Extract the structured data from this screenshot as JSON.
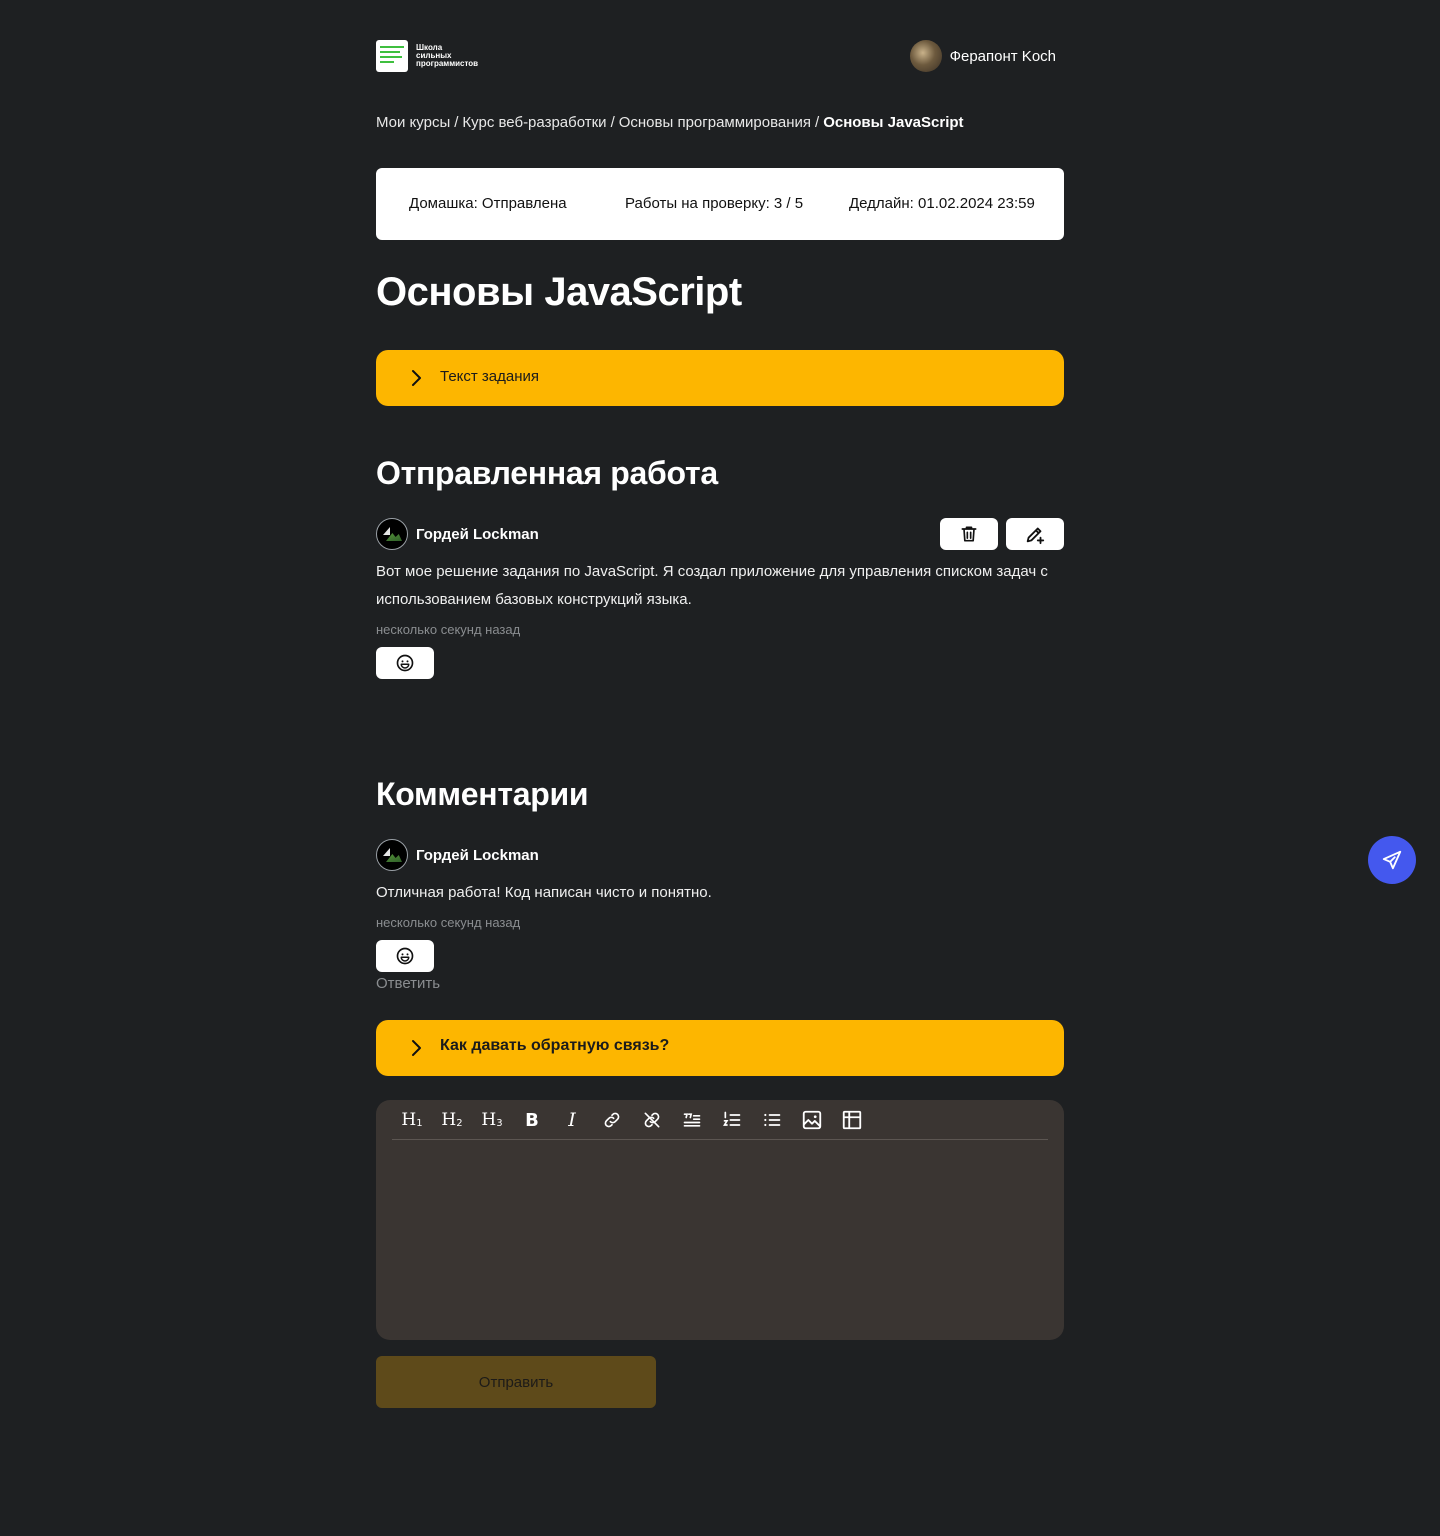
{
  "header": {
    "logo_text": [
      "Школа",
      "сильных",
      "программистов"
    ],
    "user_name": "Ферапонт Koch"
  },
  "breadcrumb": {
    "items": [
      "Мои курсы",
      "Курс веб-разработки",
      "Основы программирования"
    ],
    "current": "Основы JavaScript",
    "separator": "/"
  },
  "status": {
    "homework": "Домашка: Отправлена",
    "review": "Работы на проверку: 3 / 5",
    "deadline": "Дедлайн: 01.02.2024 23:59"
  },
  "page_title": "Основы JavaScript",
  "task_accordion": {
    "label": "Текст задания"
  },
  "submitted": {
    "heading": "Отправленная работа",
    "author": "Гордей Lockman",
    "text": "Вот мое решение задания по JavaScript. Я создал приложение для управления списком задач с использованием базовых конструкций языка.",
    "time": "несколько секунд назад"
  },
  "comments": {
    "heading": "Комментарии",
    "items": [
      {
        "author": "Гордей Lockman",
        "text": "Отличная работа! Код написан чисто и понятно.",
        "time": "несколько секунд назад",
        "reply_label": "Ответить"
      }
    ]
  },
  "feedback_accordion": {
    "label": "Как давать обратную связь?"
  },
  "editor": {
    "toolbar": [
      "heading-1",
      "heading-2",
      "heading-3",
      "bold",
      "italic",
      "link",
      "unlink",
      "blockquote",
      "ordered-list",
      "bullet-list",
      "image",
      "table"
    ],
    "value": ""
  },
  "submit_label": "Отправить",
  "colors": {
    "background": "#1e2022",
    "accent": "#fdb600",
    "editor_bg": "#3a3532",
    "fab": "#4458ee"
  }
}
